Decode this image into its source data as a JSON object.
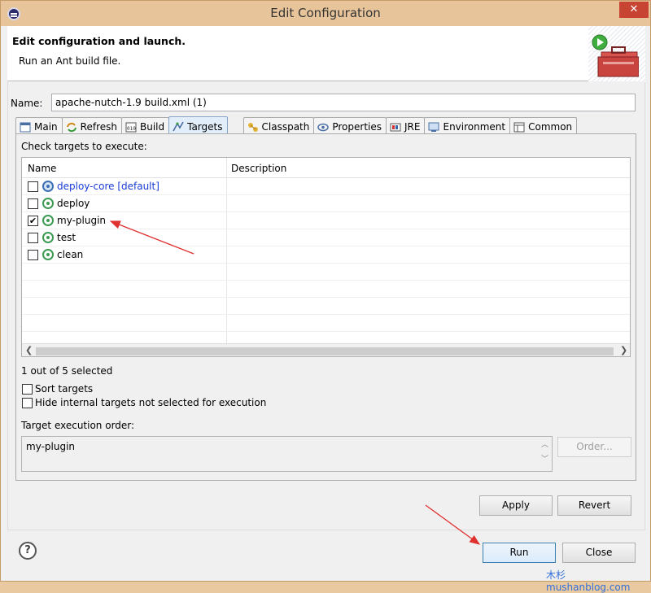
{
  "window": {
    "title": "Edit Configuration",
    "close_glyph": "✕"
  },
  "header": {
    "title": "Edit configuration and launch.",
    "subtitle": "Run an Ant build file."
  },
  "name_field": {
    "label": "Name:",
    "value": "apache-nutch-1.9 build.xml (1)"
  },
  "tabs": [
    {
      "label": "Main",
      "icon": "main-tab-icon"
    },
    {
      "label": "Refresh",
      "icon": "refresh-icon"
    },
    {
      "label": "Build",
      "icon": "build-icon"
    },
    {
      "label": "Targets",
      "icon": "targets-icon",
      "active": true
    },
    {
      "label": "Classpath",
      "icon": "classpath-icon"
    },
    {
      "label": "Properties",
      "icon": "properties-icon"
    },
    {
      "label": "JRE",
      "icon": "jre-icon"
    },
    {
      "label": "Environment",
      "icon": "environment-icon"
    },
    {
      "label": "Common",
      "icon": "common-icon"
    }
  ],
  "targets": {
    "prompt": "Check targets to execute:",
    "columns": [
      "Name",
      "Description"
    ],
    "rows": [
      {
        "name": "deploy-core [default]",
        "checked": false,
        "default": true,
        "description": ""
      },
      {
        "name": "deploy",
        "checked": false,
        "default": false,
        "description": ""
      },
      {
        "name": "my-plugin",
        "checked": true,
        "default": false,
        "description": ""
      },
      {
        "name": "test",
        "checked": false,
        "default": false,
        "description": ""
      },
      {
        "name": "clean",
        "checked": false,
        "default": false,
        "description": ""
      }
    ],
    "selection_count": "1 out of 5 selected",
    "sort_targets_label": "Sort targets",
    "hide_internal_label": "Hide internal targets not selected for execution",
    "order_label": "Target execution order:",
    "order_value": "my-plugin",
    "order_button": "Order..."
  },
  "buttons": {
    "apply": "Apply",
    "revert": "Revert",
    "run": "Run",
    "close": "Close",
    "help_glyph": "?"
  },
  "watermark": "木杉 mushanblog.com",
  "colors": {
    "titlebar": "#e8c49a",
    "annotation_arrow": "#e03030",
    "link_blue": "#1a3ad6"
  }
}
